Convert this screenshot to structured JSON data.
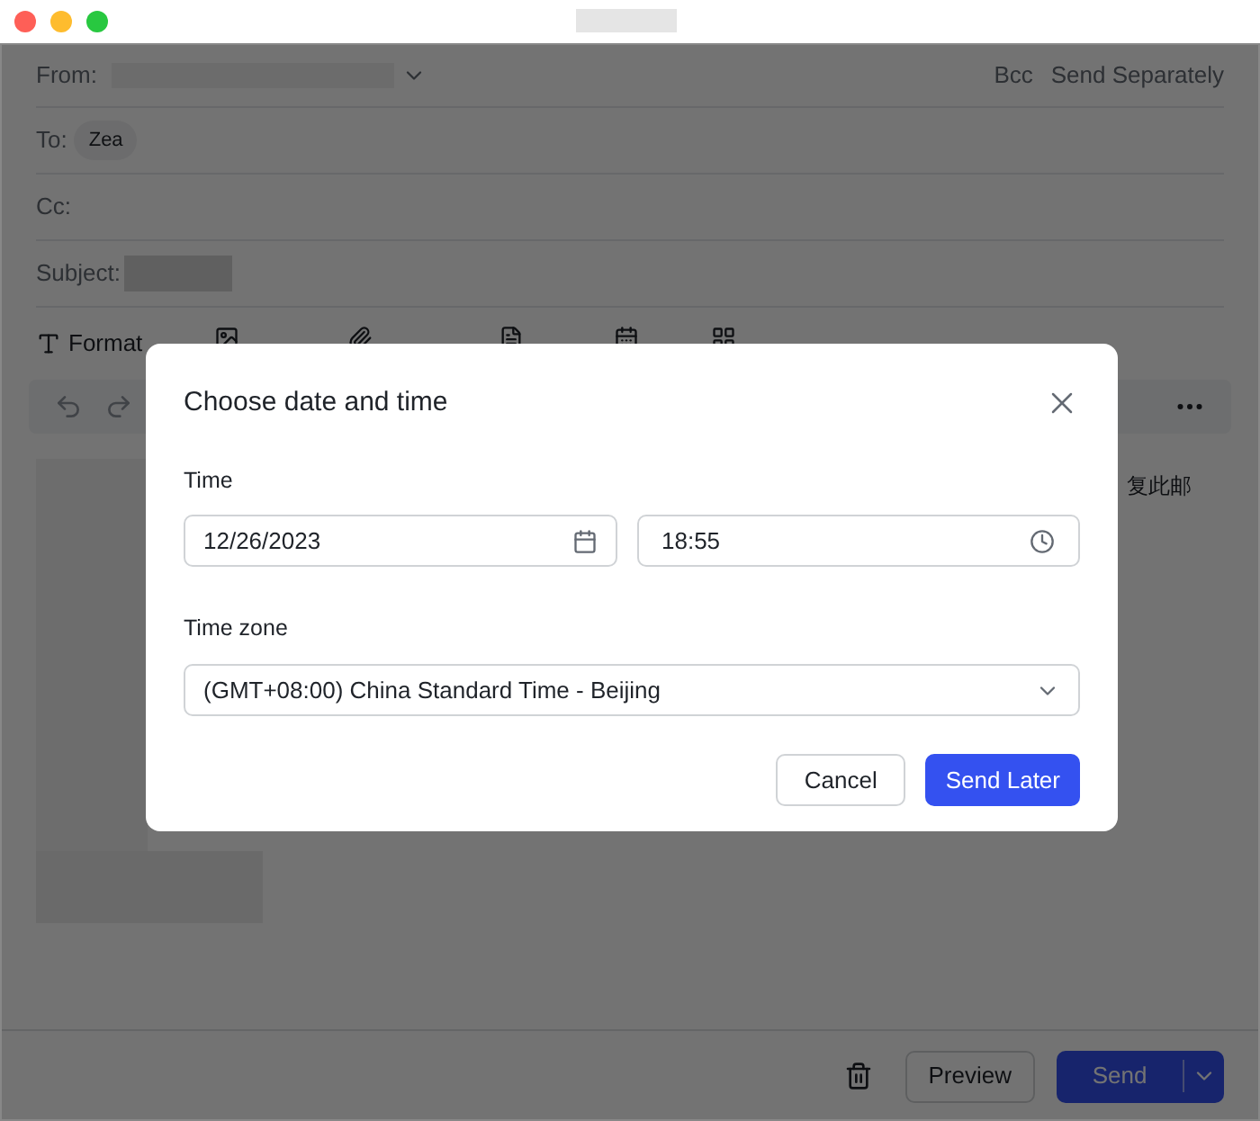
{
  "compose": {
    "from_label": "From:",
    "bcc": "Bcc",
    "send_separately": "Send Separately",
    "to_label": "To:",
    "recipients": [
      "Zea"
    ],
    "cc_label": "Cc:",
    "subject_label": "Subject:",
    "toolbar": [
      {
        "kind": "format",
        "label": "Format"
      },
      {
        "kind": "image"
      },
      {
        "kind": "attachment"
      },
      {
        "kind": "templates"
      },
      {
        "kind": "event"
      },
      {
        "kind": "advanced"
      }
    ],
    "body_text": "复此邮"
  },
  "footer": {
    "preview": "Preview",
    "send": "Send"
  },
  "dialog": {
    "title": "Choose date and time",
    "time_label": "Time",
    "date_value": "12/26/2023",
    "time_value": "18:55",
    "timezone_label": "Time zone",
    "timezone_value": "(GMT+08:00) China Standard Time - Beijing",
    "cancel": "Cancel",
    "confirm": "Send Later"
  }
}
